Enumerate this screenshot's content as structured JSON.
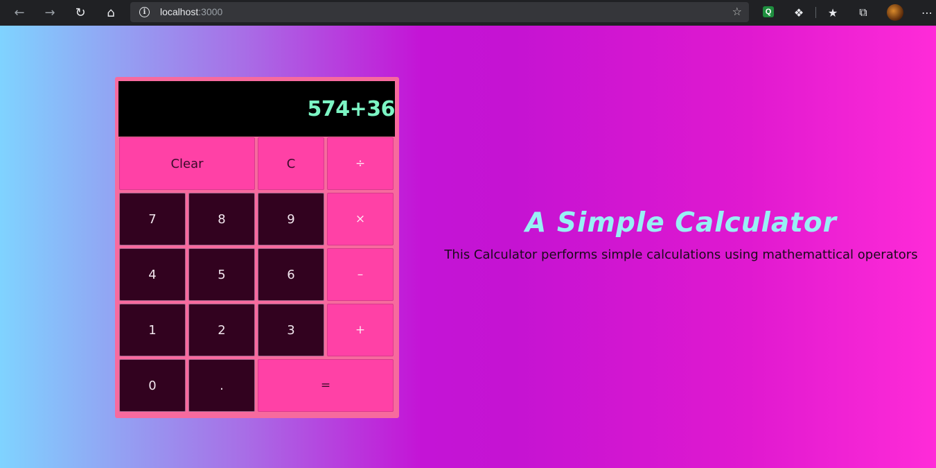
{
  "browser": {
    "url_host": "localhost",
    "url_port": ":3000",
    "icons": [
      "back-icon",
      "forward-icon",
      "reload-icon",
      "home-icon",
      "info-icon",
      "favorite-add-icon",
      "extension-q-icon",
      "extensions-icon",
      "favorites-icon",
      "collections-icon",
      "profile-avatar",
      "more-icon"
    ],
    "q_ext_label": "Q"
  },
  "calculator": {
    "display": "574+36",
    "keys": {
      "clear": "Clear",
      "c": "C",
      "divide": "÷",
      "seven": "7",
      "eight": "8",
      "nine": "9",
      "multiply": "×",
      "four": "4",
      "five": "5",
      "six": "6",
      "minus": "–",
      "one": "1",
      "two": "2",
      "three": "3",
      "plus": "+",
      "zero": "0",
      "dot": ".",
      "equals": "="
    }
  },
  "main": {
    "title": "A Simple Calculator",
    "subtitle": "This Calculator performs simple calculations using mathemattical operators"
  },
  "colors": {
    "display_bg": "#000000",
    "display_text": "#7cf5c4",
    "digit_key_bg": "#32021f",
    "operator_key_bg": "#ff41a6",
    "calculator_frame": "#f76a9e",
    "title_color": "#98f0f4"
  }
}
